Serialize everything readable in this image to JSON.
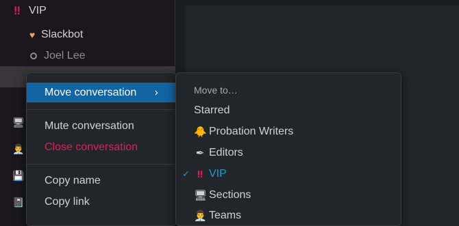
{
  "sidebar": {
    "section_vip": {
      "icon": "double-exclamation-icon",
      "icon_glyph": "‼",
      "label": "VIP"
    },
    "dms": [
      {
        "icon": "heart-icon",
        "icon_glyph": "♥",
        "label": "Slackbot"
      },
      {
        "icon": "presence-away-icon",
        "label": "Joel Lee"
      }
    ],
    "left_icons": [
      {
        "name": "computer-icon",
        "glyph": "🖥"
      },
      {
        "name": "person-in-suit-icon",
        "glyph": "👨‍💼"
      },
      {
        "name": "floppy-disk-icon",
        "glyph": "💾"
      },
      {
        "name": "notebook-icon",
        "glyph": "📓"
      }
    ]
  },
  "context_menu": {
    "move_conversation": "Move conversation",
    "chevron": "›",
    "mute_conversation": "Mute conversation",
    "close_conversation": "Close conversation",
    "copy_name": "Copy name",
    "copy_link": "Copy link"
  },
  "submenu": {
    "header": "Move to…",
    "items": [
      {
        "label": "Starred",
        "icon": "",
        "selected": false
      },
      {
        "label": "Probation Writers",
        "icon": "🐥",
        "selected": false
      },
      {
        "label": "Editors",
        "icon": "✒",
        "selected": false
      },
      {
        "label": "VIP",
        "icon": "‼",
        "selected": true
      },
      {
        "label": "Sections",
        "icon": "🖥",
        "selected": false
      },
      {
        "label": "Teams",
        "icon": "👨‍💼",
        "selected": false
      }
    ],
    "check_glyph": "✓"
  },
  "colors": {
    "accent": "#1264a3",
    "danger": "#e01e5a",
    "selected": "#1d9bd1"
  }
}
